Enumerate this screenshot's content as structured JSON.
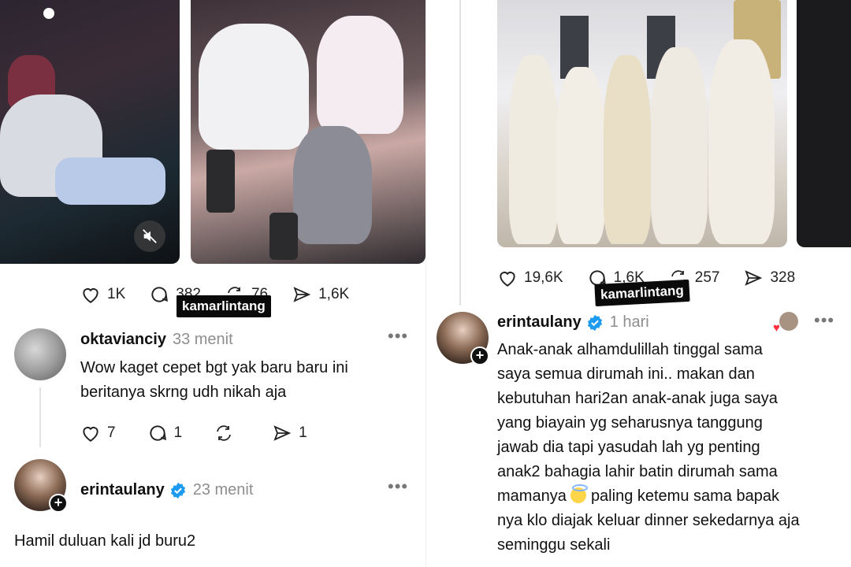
{
  "left": {
    "post_stats": {
      "likes": "1K",
      "replies": "382",
      "reposts": "76",
      "shares": "1,6K"
    },
    "watermark": "kamarlintang",
    "reply1": {
      "username": "oktavianciy",
      "time": "33 menit",
      "text_line1": "Wow kaget cepet bgt yak baru baru ini",
      "text_line2": "beritanya skrng udh nikah aja",
      "likes": "7",
      "replies": "1",
      "shares": "1"
    },
    "reply2": {
      "username": "erintaulany",
      "time": "23 menit",
      "text": "Hamil duluan kali jd buru2"
    }
  },
  "right": {
    "post_stats": {
      "likes": "19,6K",
      "replies": "1,6K",
      "reposts": "257",
      "shares": "328"
    },
    "watermark": "kamarlintang",
    "reply": {
      "username": "erintaulany",
      "time": "1 hari",
      "lines": [
        "Anak-anak alhamdulillah tinggal sama",
        "saya semua dirumah ini.. makan dan",
        "kebutuhan hari2an anak-anak juga saya",
        "yang biayain yg seharusnya tanggung",
        "jawab dia tapi yasudah lah yg penting",
        "anak2 bahagia lahir batin dirumah sama",
        "mamanya",
        "paling ketemu sama bapak",
        "nya klo diajak keluar dinner sekedarnya aja",
        "seminggu sekali"
      ]
    }
  },
  "colors": {
    "verified": "#1d9bf0",
    "muted_text": "#8e8e8e",
    "heart_react": "#ff3040"
  }
}
